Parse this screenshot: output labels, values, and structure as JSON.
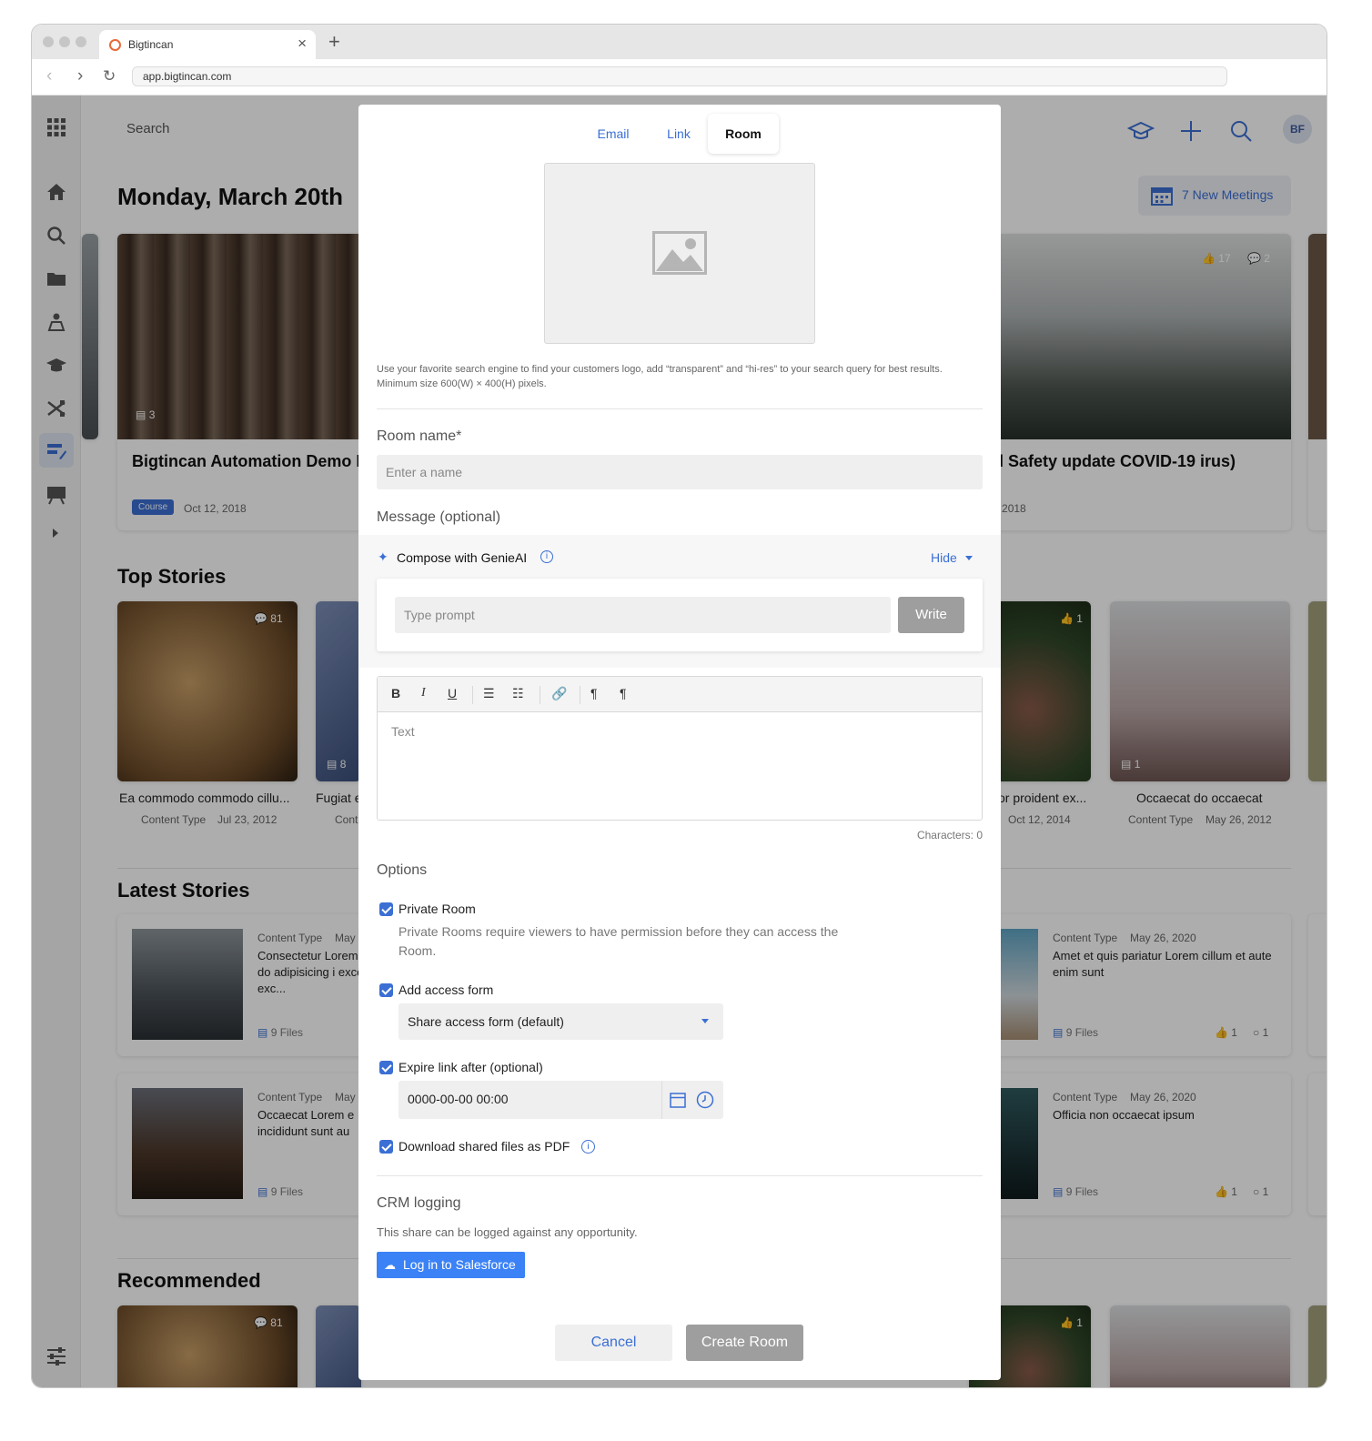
{
  "browser": {
    "tab_title": "Bigtincan",
    "url": "app.bigtincan.com"
  },
  "header": {
    "search_label": "Search",
    "avatar_initials": "BF",
    "meetings_label": "7 New Meetings"
  },
  "page": {
    "title": "Monday, March 20th"
  },
  "featured": {
    "left": {
      "title": "Bigtincan Automation Demo Marketing Ready)",
      "badge": "Course",
      "date": "Oct 12, 2018",
      "count": "3"
    },
    "right": {
      "title": "nd Safety update COVID-19 irus)",
      "date": "12, 2018",
      "likes": "17",
      "comments": "2"
    }
  },
  "sections": {
    "top_stories": "Top Stories",
    "latest_stories": "Latest Stories",
    "recommended": "Recommended"
  },
  "top_stories": [
    {
      "title": "Ea commodo commodo cillu...",
      "type": "Content Type",
      "date": "Jul 23, 2012",
      "comments": "81"
    },
    {
      "title": "Fugiat e",
      "type": "Cont",
      "count": "8"
    },
    {
      "title": "or proident ex...",
      "date": "Oct 12, 2014",
      "likes": "1"
    },
    {
      "title": "Occaecat do occaecat",
      "type": "Content Type",
      "date": "May 26, 2012",
      "count": "1"
    }
  ],
  "latest_stories": [
    {
      "type": "Content Type",
      "date": "May",
      "text": "Consectetur Lorem do do adipisicing i excepteur exc...",
      "files": "9 Files"
    },
    {
      "type": "Content Type",
      "date": "May 26, 2020",
      "text": "Amet et quis pariatur Lorem cillum et aute enim sunt",
      "files": "9 Files",
      "likes": "1",
      "comments": "1"
    },
    {
      "type": "Content Type",
      "date": "May",
      "text": "Occaecat Lorem e incididunt sunt au",
      "files": "9 Files"
    },
    {
      "type": "Content Type",
      "date": "May 26, 2020",
      "text": "Officia non occaecat ipsum",
      "files": "9 Files",
      "likes": "1",
      "comments": "1"
    }
  ],
  "recommended": [
    {
      "comments": "81"
    },
    {
      "likes": "1"
    }
  ],
  "modal": {
    "tabs": [
      "Email",
      "Link",
      "Room"
    ],
    "active_tab": "Room",
    "logo_hint": "Use your favorite search engine to find your customers logo, add “transparent” and “hi-res” to your search query for best results. Minimum size 600(W) × 400(H) pixels.",
    "room_name_label": "Room name*",
    "room_name_placeholder": "Enter a name",
    "message_label": "Message (optional)",
    "genie_label": "Compose with GenieAI",
    "hide_label": "Hide",
    "prompt_placeholder": "Type prompt",
    "write_label": "Write",
    "editor_placeholder": "Text",
    "characters": "Characters: 0",
    "options_label": "Options",
    "private_room_label": "Private Room",
    "private_room_desc": "Private Rooms require viewers to have permission before they can access the Room.",
    "access_form_label": "Add access form",
    "access_form_value": "Share access form (default)",
    "expire_label": "Expire link after (optional)",
    "expire_value": "0000-00-00 00:00",
    "download_pdf_label": "Download shared files as PDF",
    "crm_label": "CRM logging",
    "crm_desc": "This share can be logged against any opportunity.",
    "salesforce_label": "Log in to Salesforce",
    "cancel_label": "Cancel",
    "create_label": "Create Room"
  },
  "colors": {
    "accent": "#3b6fd4",
    "salesforce": "#3b82f6",
    "disabled": "#9e9e9e"
  }
}
